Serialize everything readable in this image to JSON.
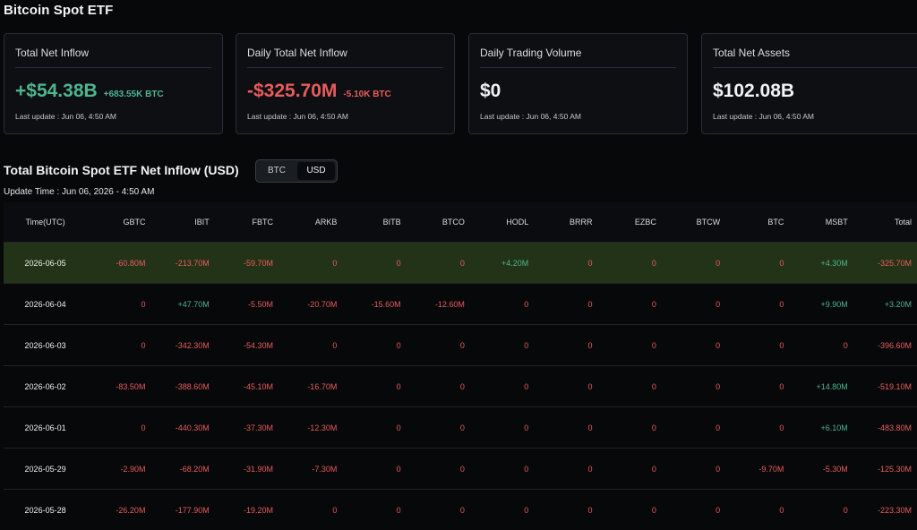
{
  "page": {
    "title": "Bitcoin Spot ETF"
  },
  "cards": [
    {
      "label": "Total Net Inflow",
      "value": "+$54.38B",
      "sub": "+683.55K BTC",
      "tone": "green",
      "update": "Last update : Jun 06, 4:50 AM"
    },
    {
      "label": "Daily Total Net Inflow",
      "value": "-$325.70M",
      "sub": "-5.10K BTC",
      "tone": "red",
      "update": "Last update : Jun 06, 4:50 AM"
    },
    {
      "label": "Daily Trading Volume",
      "value": "$0",
      "sub": "",
      "tone": "white",
      "update": "Last update : Jun 06, 4:50 AM"
    },
    {
      "label": "Total Net Assets",
      "value": "$102.08B",
      "sub": "",
      "tone": "white",
      "update": "Last update : Jun 06, 4:50 AM"
    }
  ],
  "section": {
    "title": "Total Bitcoin Spot ETF Net Inflow (USD)",
    "toggle": {
      "btc": "BTC",
      "usd": "USD",
      "selected": "USD"
    },
    "update_time": "Update Time : Jun 06, 2026 - 4:50 AM"
  },
  "table": {
    "headers": [
      "Time(UTC)",
      "GBTC",
      "IBIT",
      "FBTC",
      "ARKB",
      "BITB",
      "BTCO",
      "HODL",
      "BRRR",
      "EZBC",
      "BTCW",
      "BTC",
      "MSBT",
      "Total"
    ],
    "rows": [
      [
        "2026-06-05",
        "-60.80M",
        "-213.70M",
        "-59.70M",
        "0",
        "0",
        "0",
        "+4.20M",
        "0",
        "0",
        "0",
        "0",
        "+4.30M",
        "-325.70M"
      ],
      [
        "2026-06-04",
        "0",
        "+47.70M",
        "-5.50M",
        "-20.70M",
        "-15.60M",
        "-12.60M",
        "0",
        "0",
        "0",
        "0",
        "0",
        "+9.90M",
        "+3.20M"
      ],
      [
        "2026-06-03",
        "0",
        "-342.30M",
        "-54.30M",
        "0",
        "0",
        "0",
        "0",
        "0",
        "0",
        "0",
        "0",
        "0",
        "-396.60M"
      ],
      [
        "2026-06-02",
        "-83.50M",
        "-388.60M",
        "-45.10M",
        "-16.70M",
        "0",
        "0",
        "0",
        "0",
        "0",
        "0",
        "0",
        "+14.80M",
        "-519.10M"
      ],
      [
        "2026-06-01",
        "0",
        "-440.30M",
        "-37.30M",
        "-12.30M",
        "0",
        "0",
        "0",
        "0",
        "0",
        "0",
        "0",
        "+6.10M",
        "-483.80M"
      ],
      [
        "2026-05-29",
        "-2.90M",
        "-68.20M",
        "-31.90M",
        "-7.30M",
        "0",
        "0",
        "0",
        "0",
        "0",
        "0",
        "-9.70M",
        "-5.30M",
        "-125.30M"
      ],
      [
        "2026-05-28",
        "-26.20M",
        "-177.90M",
        "-19.20M",
        "0",
        "0",
        "0",
        "0",
        "0",
        "0",
        "0",
        "0",
        "0",
        "-223.30M"
      ]
    ]
  },
  "colors": {
    "positive": "#4fb58e",
    "negative": "#e85c5c",
    "highlight_row": "#233318"
  }
}
